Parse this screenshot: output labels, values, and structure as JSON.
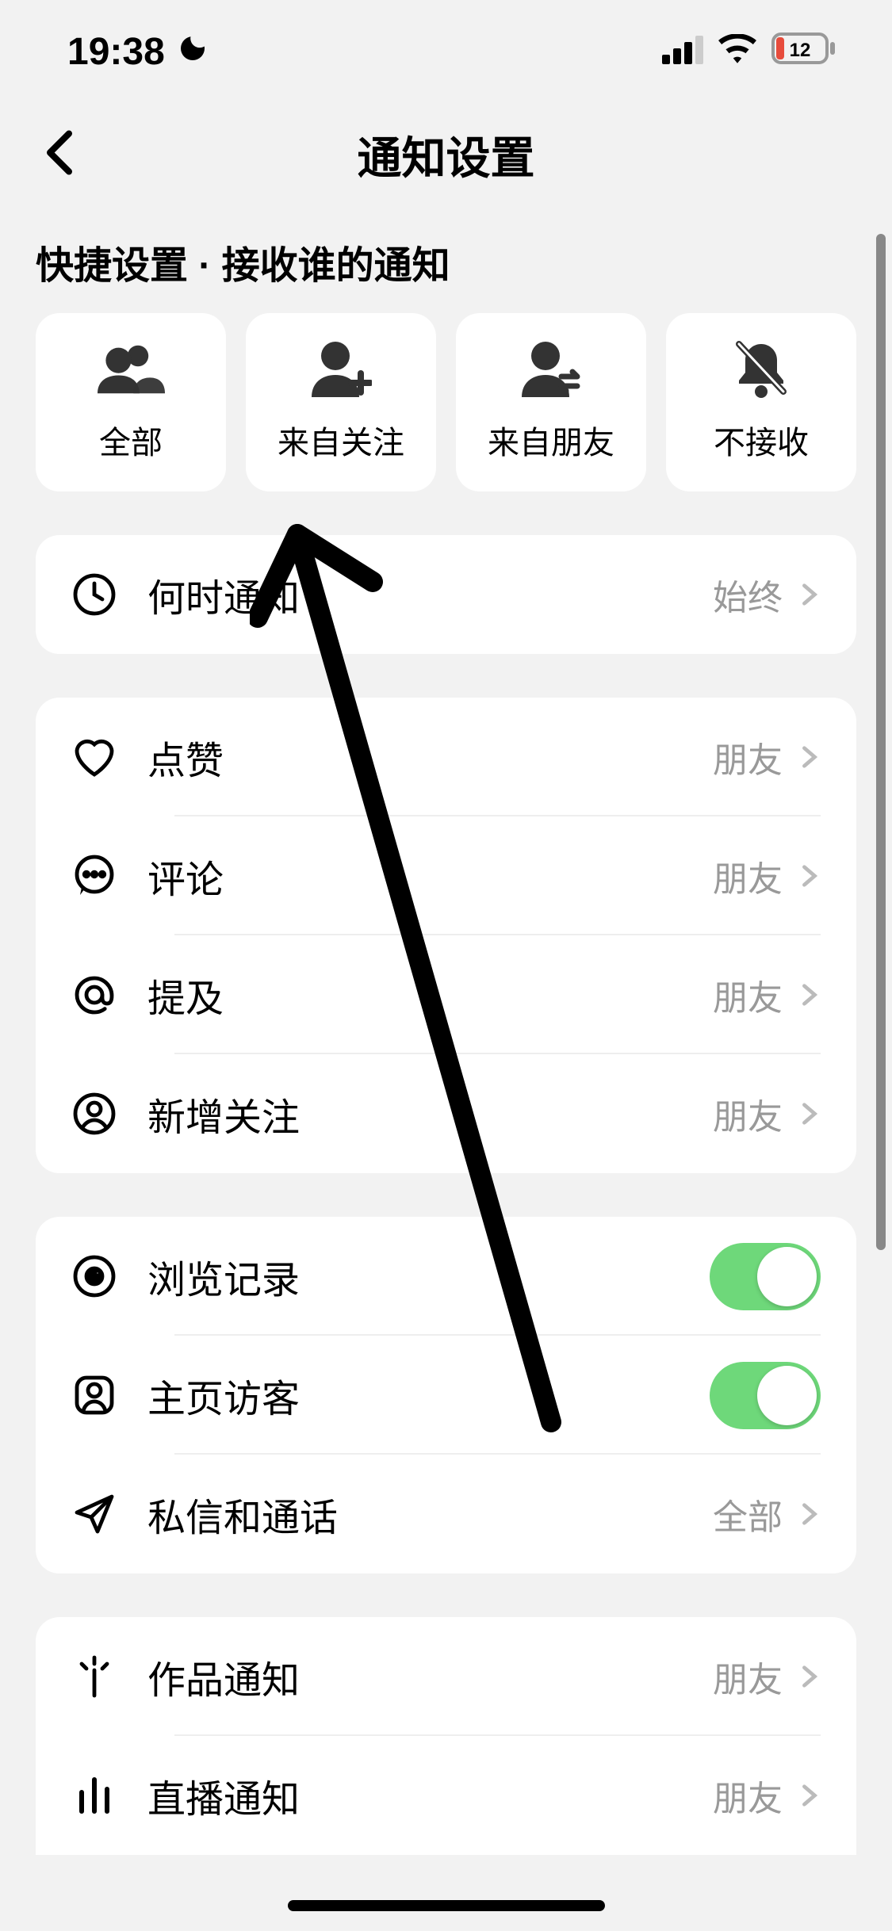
{
  "status": {
    "time": "19:38",
    "battery": "12"
  },
  "nav": {
    "title": "通知设置"
  },
  "section": {
    "header": "快捷设置 · 接收谁的通知"
  },
  "quick": [
    {
      "label": "全部"
    },
    {
      "label": "来自关注"
    },
    {
      "label": "来自朋友"
    },
    {
      "label": "不接收"
    }
  ],
  "group1": {
    "when": {
      "label": "何时通知",
      "value": "始终"
    }
  },
  "group2": {
    "likes": {
      "label": "点赞",
      "value": "朋友"
    },
    "comments": {
      "label": "评论",
      "value": "朋友"
    },
    "mentions": {
      "label": "提及",
      "value": "朋友"
    },
    "followers": {
      "label": "新增关注",
      "value": "朋友"
    }
  },
  "group3": {
    "history": {
      "label": "浏览记录",
      "on": true
    },
    "visitors": {
      "label": "主页访客",
      "on": true
    },
    "messages": {
      "label": "私信和通话",
      "value": "全部"
    }
  },
  "group4": {
    "works": {
      "label": "作品通知",
      "value": "朋友"
    },
    "live": {
      "label": "直播通知",
      "value": "朋友"
    }
  }
}
